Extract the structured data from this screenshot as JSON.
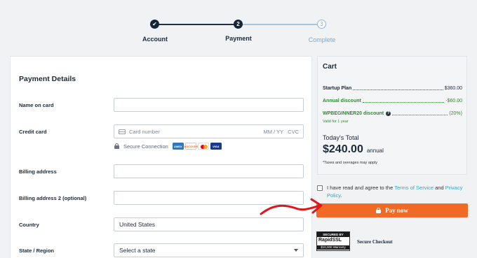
{
  "stepper": {
    "steps": [
      {
        "label": "Account",
        "state": "done",
        "marker": "✔"
      },
      {
        "label": "Payment",
        "state": "active",
        "marker": "2"
      },
      {
        "label": "Complete",
        "state": "todo",
        "marker": "3"
      }
    ]
  },
  "payment": {
    "title": "Payment Details",
    "fields": {
      "name_label": "Name on card",
      "card_label": "Credit card",
      "card_number_placeholder": "Card number",
      "card_expiry_placeholder": "MM / YY",
      "card_cvc_placeholder": "CVC",
      "secure_connection": "Secure Connection",
      "card_brands": [
        "AMEX",
        "DISCOVER",
        "mastercard",
        "VISA"
      ],
      "billing_label": "Billing address",
      "billing2_label": "Billing address 2 (optional)",
      "country_label": "Country",
      "country_value": "United States",
      "state_label": "State / Region",
      "state_value": "Select a state"
    }
  },
  "cart": {
    "title": "Cart",
    "rows": [
      {
        "label": "Startup Plan",
        "amount": "$360.00"
      },
      {
        "label": "Annual discount",
        "amount": "-$60.00"
      },
      {
        "label": "WPBEGINNER20 discount",
        "amount": "(20%)"
      }
    ],
    "valid_note": "Valid for 1 year",
    "today_total_label": "Today's Total",
    "total_amount": "$240.00",
    "total_unit": "annual",
    "tax_note": "*Taxes and overages may apply"
  },
  "agree": {
    "text_before": "I have read and agree to the ",
    "tos": "Terms of Service",
    "and": " and ",
    "privacy": "Privacy Policy",
    "period": "."
  },
  "pay_button": "Pay now",
  "ssl_badge": {
    "top": "SECURED BY",
    "mid": "RapidSSL",
    "bottom": "$10,000 Warranty"
  },
  "secure_checkout": "Secure Checkout",
  "colors": {
    "accent": "#f06a26",
    "green": "#2d8a2d",
    "link": "#31a7c6",
    "dark": "#14253a"
  }
}
